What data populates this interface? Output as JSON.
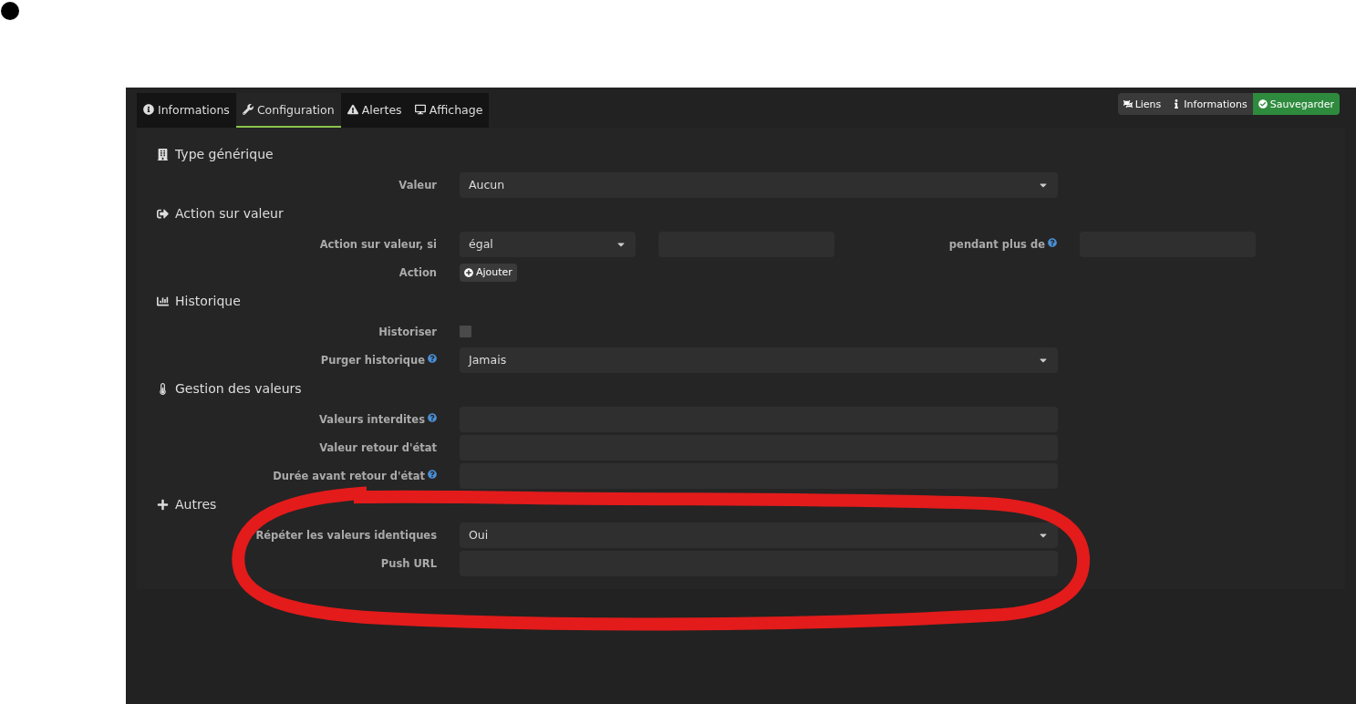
{
  "tabs": [
    {
      "label": "Informations",
      "selected": false
    },
    {
      "label": "Configuration",
      "selected": true
    },
    {
      "label": "Alertes",
      "selected": false
    },
    {
      "label": "Affichage",
      "selected": false
    }
  ],
  "actions": [
    {
      "label": "Liens",
      "kind": "default"
    },
    {
      "label": "Informations",
      "kind": "default"
    },
    {
      "label": "Sauvegarder",
      "kind": "success"
    }
  ],
  "sections": [
    {
      "title": "Type générique",
      "rows": [
        {
          "kind": "select",
          "label": "Valeur",
          "help": false,
          "value": "Aucun"
        }
      ]
    },
    {
      "title": "Action sur valeur",
      "rows": [
        {
          "kind": "compare",
          "label": "Action sur valeur, si",
          "help": false,
          "value": "égal",
          "second_label": "pendant plus de",
          "second_help": true
        },
        {
          "kind": "button",
          "label": "Action",
          "help": false,
          "button": "Ajouter"
        }
      ]
    },
    {
      "title": "Historique",
      "rows": [
        {
          "kind": "checkbox",
          "label": "Historiser",
          "help": false,
          "checked": false
        },
        {
          "kind": "select",
          "label": "Purger historique",
          "help": true,
          "value": "Jamais"
        }
      ]
    },
    {
      "title": "Gestion des valeurs",
      "rows": [
        {
          "kind": "input",
          "label": "Valeurs interdites",
          "help": true
        },
        {
          "kind": "input",
          "label": "Valeur retour d'état",
          "help": false
        },
        {
          "kind": "input",
          "label": "Durée avant retour d'état",
          "help": true
        }
      ]
    },
    {
      "title": "Autres",
      "rows": [
        {
          "kind": "select",
          "label": "Répéter les valeurs identiques",
          "help": false,
          "value": "Oui"
        },
        {
          "kind": "input",
          "label": "Push URL",
          "help": false
        }
      ]
    }
  ]
}
